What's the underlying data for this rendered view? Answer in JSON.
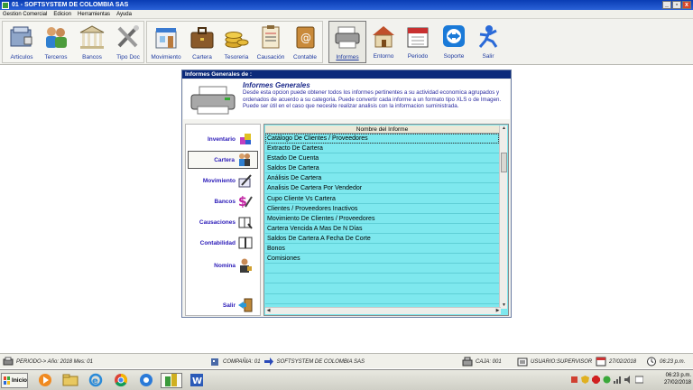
{
  "window": {
    "title": "01 - SOFTSYSTEM DE COLOMBIA SAS",
    "buttons": [
      "_",
      "▫",
      "x"
    ]
  },
  "menu": [
    "Gestion Comercial",
    "Edicion",
    "Herramientas",
    "Ayuda"
  ],
  "toolbar": {
    "group1": [
      {
        "label": "Articulos",
        "icon": "articles-icon"
      },
      {
        "label": "Terceros",
        "icon": "people-icon"
      },
      {
        "label": "Bancos",
        "icon": "bank-icon"
      },
      {
        "label": "Tipo Doc",
        "icon": "tools-icon"
      }
    ],
    "group2": [
      {
        "label": "Movimiento",
        "icon": "shop-icon"
      },
      {
        "label": "Cartera",
        "icon": "briefcase-icon"
      },
      {
        "label": "Tesoreria",
        "icon": "coins-icon"
      },
      {
        "label": "Causación",
        "icon": "clipboard-icon"
      },
      {
        "label": "Contable",
        "icon": "address-book-icon"
      }
    ],
    "group3": [
      {
        "label": "Informes",
        "icon": "printer-icon",
        "active": true
      },
      {
        "label": "Entorno",
        "icon": "house-icon"
      },
      {
        "label": "Periodo",
        "icon": "calendar-icon"
      },
      {
        "label": "Soporte",
        "icon": "teamviewer-icon"
      },
      {
        "label": "Salir",
        "icon": "exit-icon"
      }
    ]
  },
  "dialog": {
    "title": "Informes Generales de :",
    "header_title": "Informes Generales",
    "header_text": "Desde esta opcion puede obtener todos los informes pertinentes a su actividad economica agrupados y ordenados de acuerdo a su categoria. Puede convertir cada informe a un formato tipo XLS o de Imagen. Puede ser útil en el caso que necesite realizar analisis con la informacion suministrada.",
    "categories": [
      {
        "label": "Inventario",
        "icon": "inventory-icon"
      },
      {
        "label": "Cartera",
        "icon": "people-icon",
        "selected": true
      },
      {
        "label": "Movimiento",
        "icon": "pen-icon"
      },
      {
        "label": "Bancos",
        "icon": "money-icon"
      },
      {
        "label": "Causaciones",
        "icon": "book-icon"
      },
      {
        "label": "Contabilidad",
        "icon": "ledger-icon"
      },
      {
        "label": "Nomina",
        "icon": "employee-icon"
      }
    ],
    "exit_label": "Salir",
    "grid_header": "Nombre del Informe",
    "reports": [
      "Catálogo De Clientes / Proveedores",
      "Extracto De Cartera",
      "Estado De Cuenta",
      "Saldos De Cartera",
      "Análisis De Cartera",
      "Analisis De Cartera Por Vendedor",
      "Cupo Cliente Vs Cartera",
      "Clientes / Proveedores Inactivos",
      "Movimiento De Clientes / Proveedores",
      "Cartera Vencida A Mas De N Días",
      "Saldos De Cartera A Fecha De Corte",
      "Bonos",
      "Comisiones",
      "",
      "",
      "",
      ""
    ]
  },
  "status": {
    "periodo": "PERIODO-> Año: 2018  Mes: 01",
    "compania_label": "COMPAÑIA: 01",
    "compania_name": "SOFTSYSTEM DE COLOMBIA SAS",
    "caja": "CAJA: 001",
    "usuario": "USUARIO:SUPERVISOR",
    "fecha": "27/02/2018",
    "hora": "06:23 p.m."
  },
  "taskbar": {
    "start_label": "Inicio",
    "clock_time": "06:23 p.m.",
    "clock_date": "27/02/2018"
  },
  "colors": {
    "titlebar": "#0a3db4",
    "grid_bg": "#7ee8ee",
    "label_blue": "#1e3aa0"
  }
}
